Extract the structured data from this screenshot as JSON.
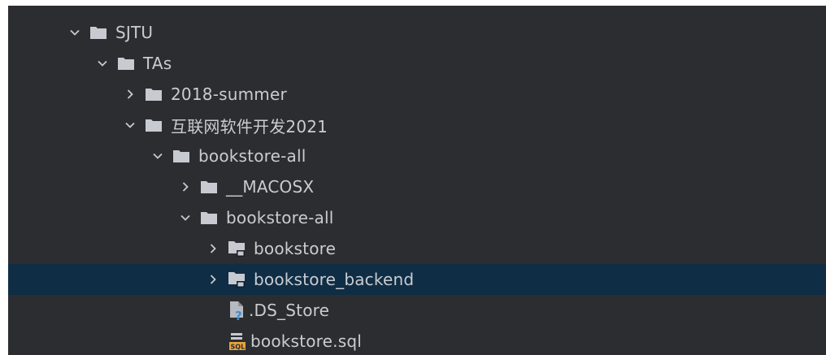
{
  "tree": {
    "items": [
      {
        "label": "SJTU",
        "expanded": true,
        "icon": "folder-icon"
      },
      {
        "label": "TAs",
        "expanded": true,
        "icon": "folder-icon"
      },
      {
        "label": "2018-summer",
        "expanded": false,
        "icon": "folder-icon"
      },
      {
        "label": "互联网软件开发2021",
        "expanded": true,
        "icon": "folder-icon"
      },
      {
        "label": "bookstore-all",
        "expanded": true,
        "icon": "folder-icon"
      },
      {
        "label": "__MACOSX",
        "expanded": false,
        "icon": "folder-icon"
      },
      {
        "label": "bookstore-all",
        "expanded": true,
        "icon": "folder-icon"
      },
      {
        "label": "bookstore",
        "expanded": false,
        "icon": "module-folder-icon"
      },
      {
        "label": "bookstore_backend",
        "expanded": false,
        "icon": "module-folder-icon",
        "selected": true
      },
      {
        "label": ".DS_Store",
        "icon": "unknown-file-icon"
      },
      {
        "label": "bookstore.sql",
        "icon": "sql-file-icon"
      }
    ]
  },
  "colors": {
    "background": "#2b2d30",
    "selection": "#0f2d44",
    "text": "#c9ccd1",
    "folder": "#c7cad0",
    "chevron": "#c7cad0",
    "question_mark": "#3e8ed0",
    "sql_badge": "#e8a33d"
  }
}
